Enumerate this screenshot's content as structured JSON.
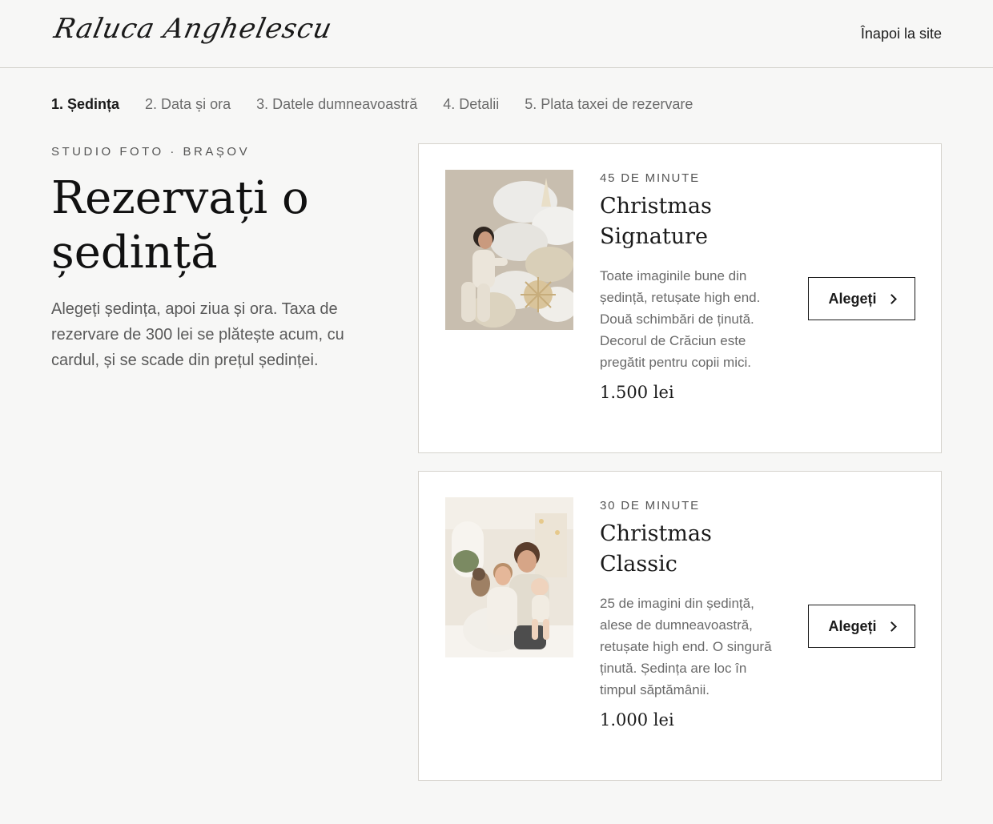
{
  "header": {
    "logo": "Raluca Anghelescu",
    "back_link": "Înapoi la site"
  },
  "steps": [
    {
      "label": "1. Ședința",
      "active": true
    },
    {
      "label": "2. Data și ora",
      "active": false
    },
    {
      "label": "3. Datele dumneavoastră",
      "active": false
    },
    {
      "label": "4. Detalii",
      "active": false
    },
    {
      "label": "5. Plata taxei de rezervare",
      "active": false
    }
  ],
  "intro": {
    "eyebrow": "STUDIO FOTO · BRAȘOV",
    "title": "Rezervați o ședință",
    "text": "Alegeți ședința, apoi ziua și ora. Taxa de rezervare de 300 lei se plătește acum, cu cardul, și se scade din prețul ședinței."
  },
  "sessions": [
    {
      "duration": "45 DE MINUTE",
      "name": "Christmas Signature",
      "description": "Toate imaginile bune din ședință, retușate high end. Două schimbări de ținută. Decorul de Crăciun este pregătit pentru copii mici.",
      "price": "1.500 lei",
      "button": "Alegeți"
    },
    {
      "duration": "30 DE MINUTE",
      "name": "Christmas Classic",
      "description": "25 de imagini din ședință, alese de dumneavoastră, retușate high end. O singură ținută. Ședința are loc în timpul săptămânii.",
      "price": "1.000 lei",
      "button": "Alegeți"
    }
  ]
}
